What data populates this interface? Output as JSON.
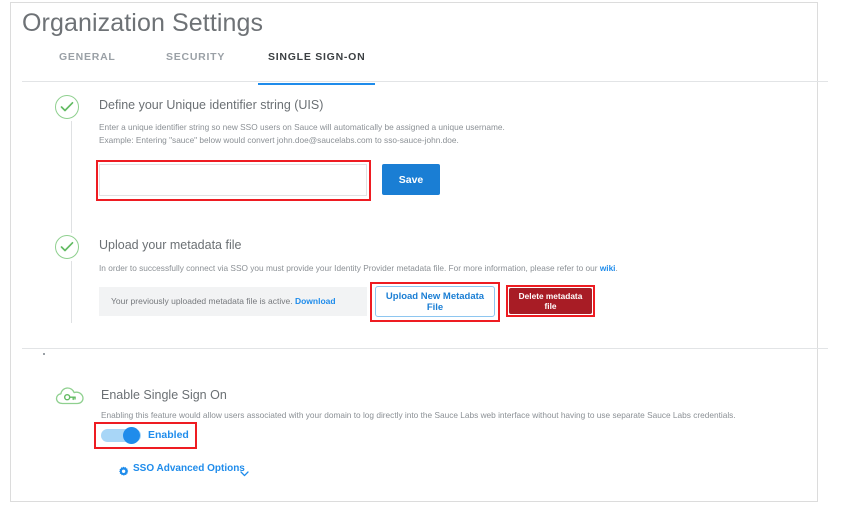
{
  "page": {
    "title": "Organization Settings"
  },
  "tabs": [
    {
      "label": "GENERAL",
      "active": false
    },
    {
      "label": "SECURITY",
      "active": false
    },
    {
      "label": "SINGLE SIGN-ON",
      "active": true
    }
  ],
  "sections": {
    "uis": {
      "status_icon": "green-check-circle-icon",
      "title": "Define your Unique identifier string (UIS)",
      "body_line1": "Enter a unique identifier string so new SSO users on Sauce will automatically be assigned a unique username.",
      "body_line2": "Example: Entering \"sauce\" below would convert john.doe@saucelabs.com to sso-sauce-john.doe.",
      "input_value": "",
      "input_placeholder": "",
      "save_label": "Save"
    },
    "metadata": {
      "status_icon": "green-check-circle-icon",
      "title": "Upload your metadata file",
      "body": "In order to successfully connect via SSO you must provide your Identity Provider metadata file. For more information, please refer to our ",
      "body_link": "wiki",
      "body_tail": ".",
      "strip_text": "Your previously uploaded metadata file is active. ",
      "strip_link": "Download",
      "upload_label": "Upload New Metadata File",
      "delete_label": "Delete metadata file"
    },
    "enable_sso": {
      "status_icon": "green-cloud-key-icon",
      "title": "Enable Single Sign On",
      "body": "Enabling this feature would allow users associated with your domain to log directly into the Sauce Labs web interface without having to use separate Sauce Labs credentials.",
      "toggle_state": "on",
      "toggle_label": "Enabled",
      "advanced_icon": "gear-icon",
      "advanced_label": "SSO Advanced Options",
      "advanced_chevron": "chevron-down-icon"
    }
  },
  "colors": {
    "accent_blue": "#1f8ceb",
    "button_blue": "#1a7ed4",
    "danger_red": "#a81c25",
    "annotation_red": "#ee1c22",
    "step_green": "#8fd08f",
    "text_gray": "#8b9095"
  }
}
